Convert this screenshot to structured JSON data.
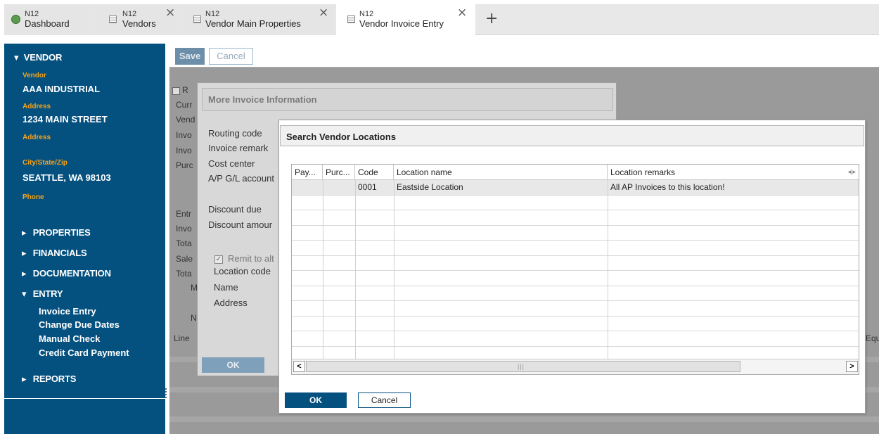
{
  "tabs": [
    {
      "app": "N12",
      "title": "Dashboard",
      "icon": "dashboard-icon"
    },
    {
      "app": "N12",
      "title": "Vendors",
      "icon": "document-icon"
    },
    {
      "app": "N12",
      "title": "Vendor Main Properties",
      "icon": "document-icon"
    },
    {
      "app": "N12",
      "title": "Vendor Invoice Entry",
      "icon": "document-icon"
    }
  ],
  "add_tab": "+",
  "close_glyph": "×",
  "sidebar": {
    "vendor_section": "VENDOR",
    "fields": [
      {
        "label": "Vendor",
        "value": "AAA INDUSTRIAL"
      },
      {
        "label": "Address",
        "value": "1234 MAIN STREET"
      },
      {
        "label": "Address",
        "value": ""
      },
      {
        "label": "City/State/Zip",
        "value": "SEATTLE, WA 98103"
      },
      {
        "label": "Phone",
        "value": ""
      }
    ],
    "sections": [
      "PROPERTIES",
      "FINANCIALS",
      "DOCUMENTATION"
    ],
    "entry_section": "ENTRY",
    "entry_items": [
      "Invoice Entry",
      "Change Due Dates",
      "Manual Check",
      "Credit Card Payment"
    ],
    "reports_section": "REPORTS",
    "collapsed_arrow": "▸",
    "expanded_arrow": "▾"
  },
  "toolbar": {
    "save": "Save",
    "cancel": "Cancel"
  },
  "background_form": {
    "labels": [
      "R",
      "Curr",
      "Vend",
      "Invo",
      "Invo",
      "Purc",
      "Entr",
      "Invo",
      "Tota",
      "Sale",
      "Tota",
      "M",
      "N",
      "Line",
      "Equ"
    ]
  },
  "more_info_dialog": {
    "title": "More Invoice Information",
    "labels": [
      "Routing code",
      "Invoice remark",
      "Cost center",
      "A/P G/L account",
      "Discount due",
      "Discount amour"
    ],
    "remit_checkbox": "Remit to alt",
    "remit_checked": true,
    "remit_labels": [
      "Location code",
      "Name",
      "Address"
    ],
    "ok": "OK"
  },
  "search_dialog": {
    "title": "Search Vendor Locations",
    "columns": [
      "Pay...",
      "Purc...",
      "Code",
      "Location name",
      "Location remarks"
    ],
    "rows": [
      {
        "pay": "",
        "purc": "",
        "code": "0001",
        "name": "Eastside Location",
        "remarks": "All AP Invoices to this location!"
      }
    ],
    "empty_rows": 12,
    "scroll_left": "<",
    "scroll_right": ">",
    "scroll_grip": "|||",
    "column_resize": "◂|▸",
    "ok": "OK",
    "cancel": "Cancel"
  }
}
